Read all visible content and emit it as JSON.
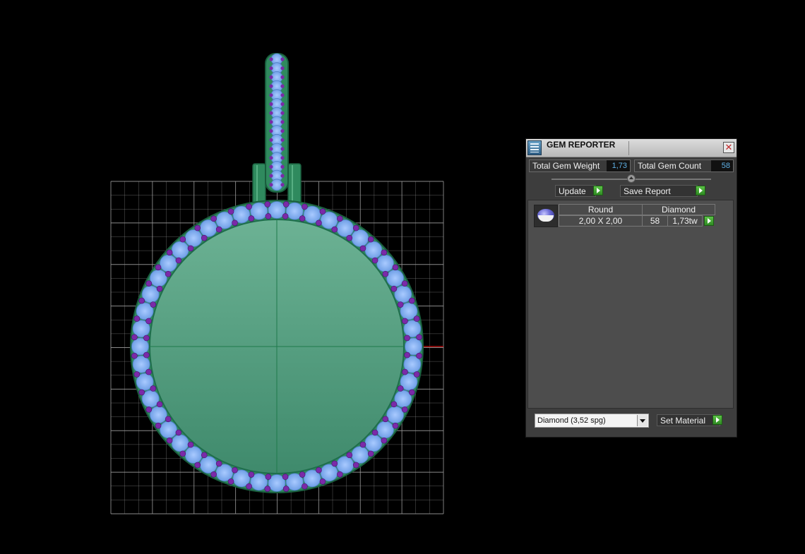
{
  "gem_reporter": {
    "title": "GEM REPORTER",
    "close_icon": "close-icon",
    "total_gem_weight_label": "Total Gem Weight",
    "total_gem_weight_value": "1,73",
    "total_gem_count_label": "Total Gem Count",
    "total_gem_count_value": "58",
    "update_label": "Update",
    "save_report_label": "Save Report",
    "table": {
      "shape_header": "Round",
      "material_header": "Diamond",
      "size": "2,00 X 2,00",
      "count": "58",
      "weight": "1,73tw",
      "thumbnail_icon": "round-gem-icon"
    },
    "material_select_value": "Diamond    (3,52 spg)",
    "set_material_label": "Set Material"
  },
  "viewport": {
    "grid_color": "#9a9a9a",
    "metal_color": "#4f9c7e",
    "gem_color": "#7fb0f0",
    "prong_color": "#7a2aa8",
    "axis_x_color": "#b01010"
  }
}
